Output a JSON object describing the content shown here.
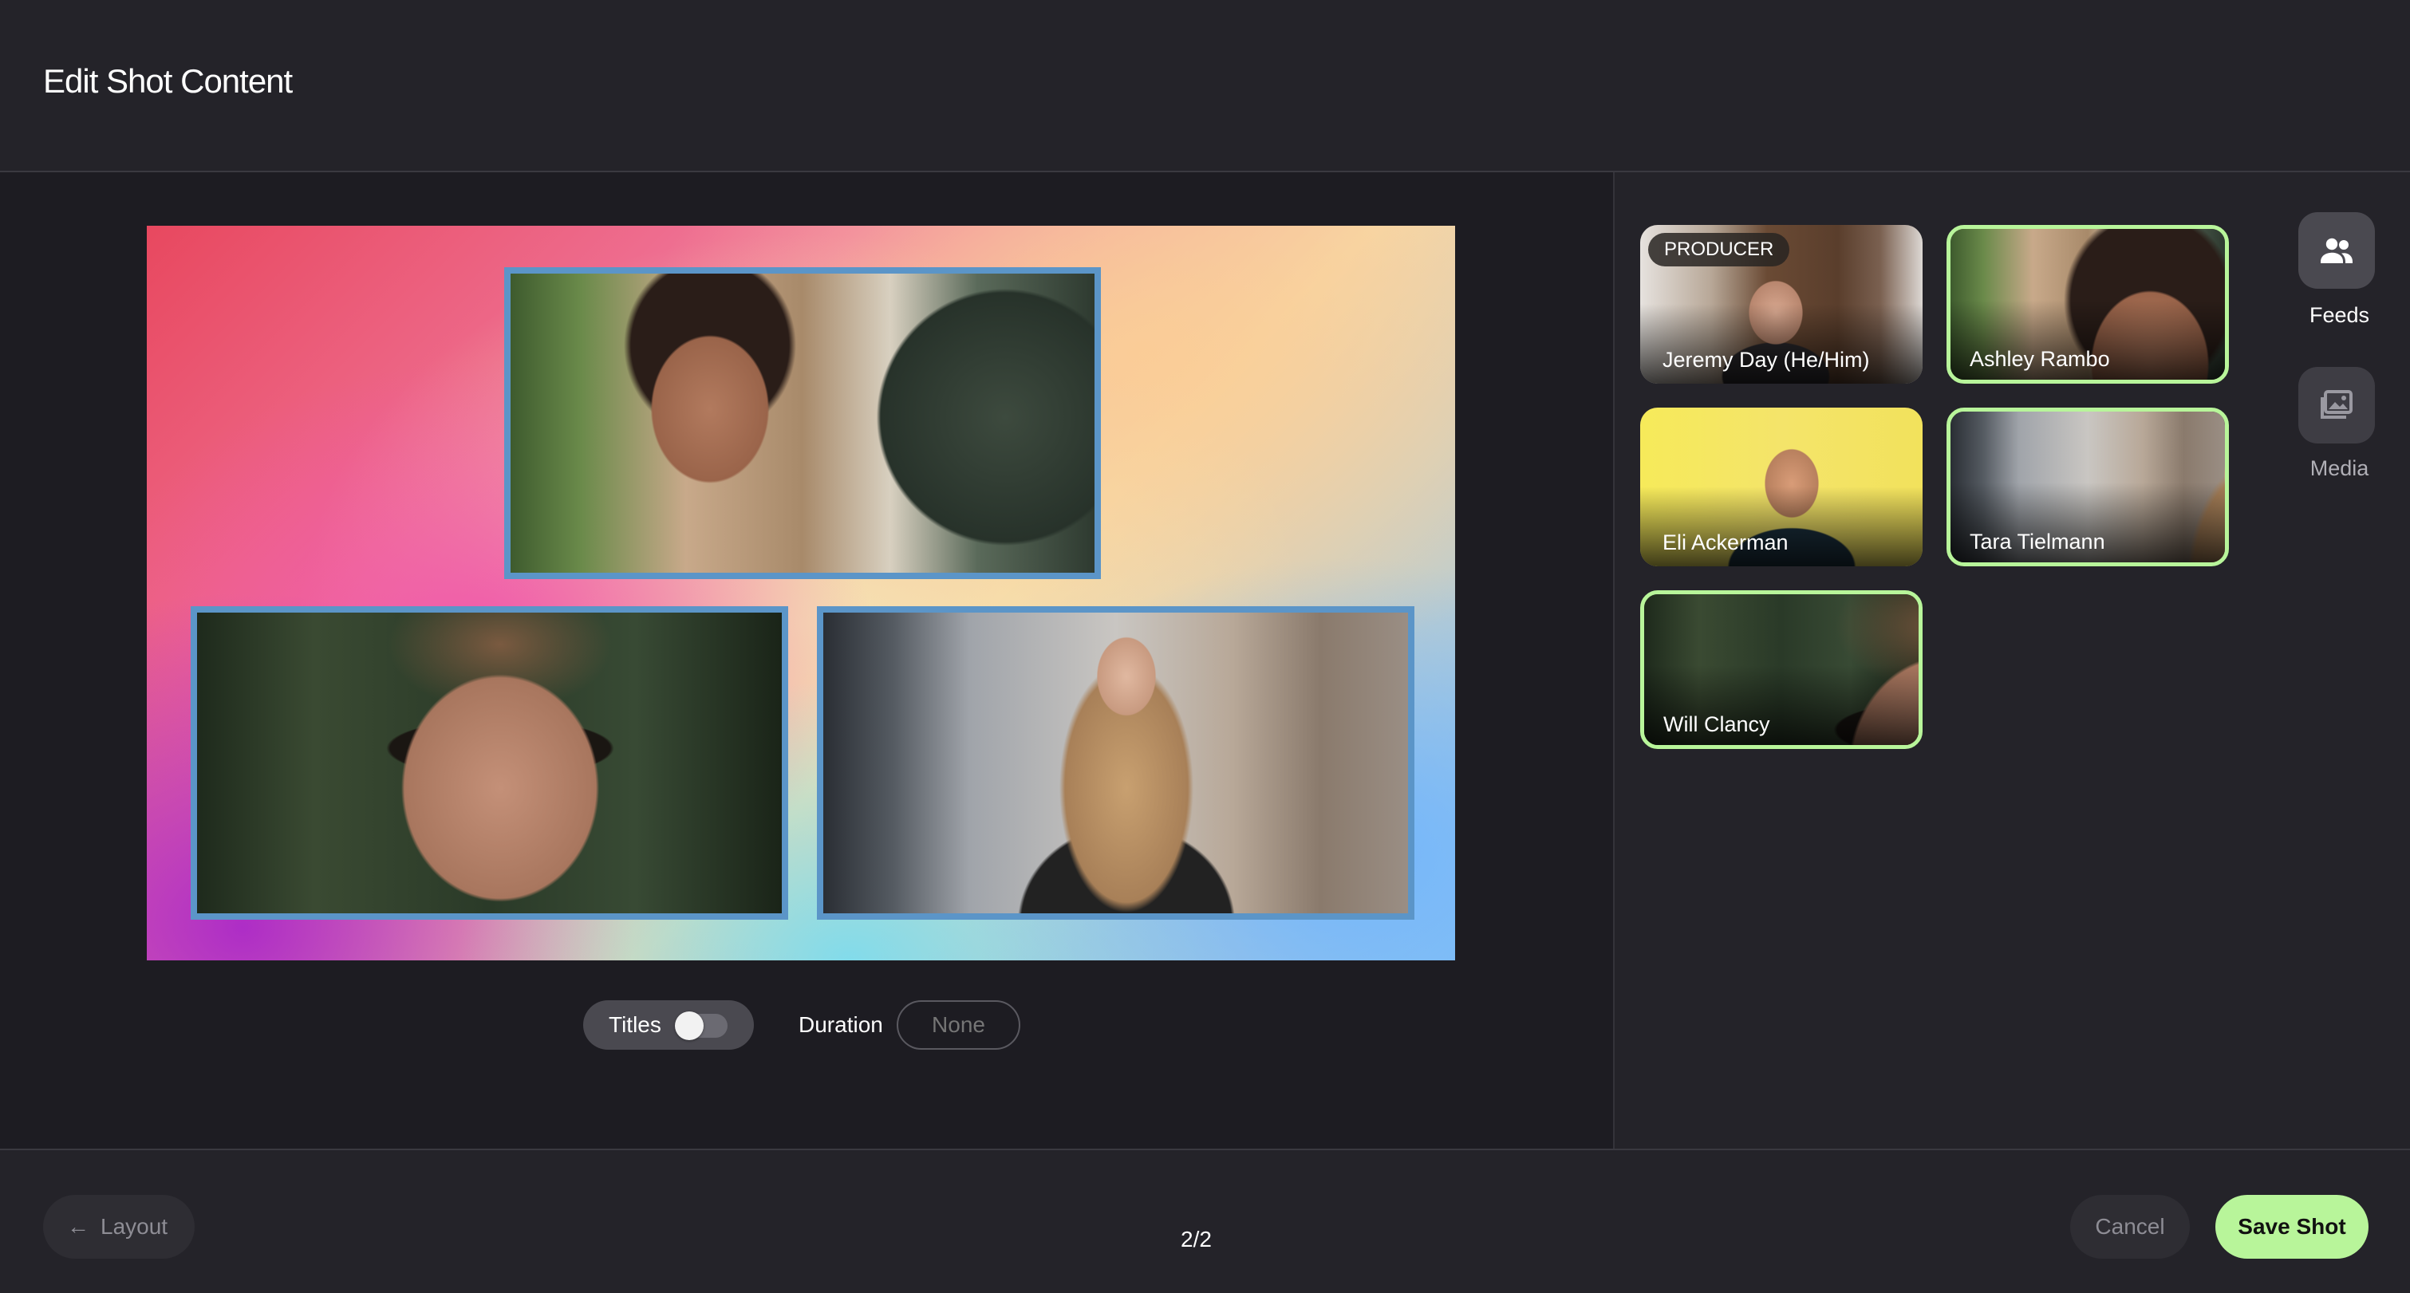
{
  "header": {
    "title": "Edit Shot Content"
  },
  "canvas": {
    "tiles": [
      {
        "person": "Ashley Rambo"
      },
      {
        "person": "Will Clancy"
      },
      {
        "person": "Tara Tielmann"
      }
    ]
  },
  "controls": {
    "titles_label": "Titles",
    "titles_enabled": false,
    "duration_label": "Duration",
    "duration_placeholder": "None"
  },
  "feeds": [
    {
      "name": "Jeremy Day (He/Him)",
      "badge": "PRODUCER",
      "selected": false
    },
    {
      "name": "Ashley Rambo",
      "selected": true
    },
    {
      "name": "Eli Ackerman",
      "selected": false
    },
    {
      "name": "Tara Tielmann",
      "selected": true
    },
    {
      "name": "Will Clancy",
      "selected": true
    }
  ],
  "rail": {
    "feeds_label": "Feeds",
    "media_label": "Media",
    "feeds_icon": "people-icon",
    "media_icon": "image-gallery-icon"
  },
  "footer": {
    "back_arrow": "←",
    "layout_label": "Layout",
    "pager": "2/2",
    "cancel_label": "Cancel",
    "save_label": "Save Shot"
  },
  "colors": {
    "accent": "#b8f59a",
    "tile_border": "#5b95c8",
    "background": "#1d1c22",
    "panel": "#242329"
  }
}
